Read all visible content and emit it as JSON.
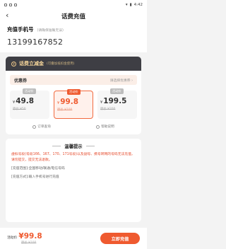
{
  "status_bar": {
    "icons_left": [
      "notification-icon",
      "notification-icon",
      "notification-icon"
    ],
    "time": "4:42"
  },
  "nav": {
    "back": "‹",
    "title": "话费充值"
  },
  "phone": {
    "label": "充值手机号",
    "hint": "(请确保准确无误)",
    "number": "13199167852"
  },
  "promo": {
    "title": "话费立减金",
    "subtitle": "(可叠加抵扣金使用)"
  },
  "coupon": {
    "label": "优惠券",
    "action": "请选择优惠券 ›"
  },
  "options": [
    {
      "tag": "活动价",
      "currency": "¥",
      "price": "49.8",
      "orig": "原价 ¥50",
      "selected": false
    },
    {
      "tag": "活动价",
      "currency": "¥",
      "price": "99.8",
      "orig": "原价 ¥100",
      "selected": true
    },
    {
      "tag": "活动价",
      "currency": "¥",
      "price": "199.5",
      "orig": "原价 ¥200",
      "selected": false
    }
  ],
  "links": {
    "orders": "订单查询",
    "help": "帮助说明"
  },
  "tips": {
    "title": "温馨提示",
    "t1": "虚拟号段(号段166、167、170、171号段)以及副号、携号转网的号码无法充值，请勿提交，提交无法退款。",
    "t2": "[充值范围]:全国移动/联通/电信号码",
    "t3": "[充值方式]:输入手机号进行充值"
  },
  "footer": {
    "label": "活动价",
    "currency": "¥",
    "price": "99.8",
    "orig": "原价 ¥100",
    "pay": "立即充值"
  },
  "colors": {
    "accent": "#ef5a2f",
    "banner": "#3e3e44"
  }
}
